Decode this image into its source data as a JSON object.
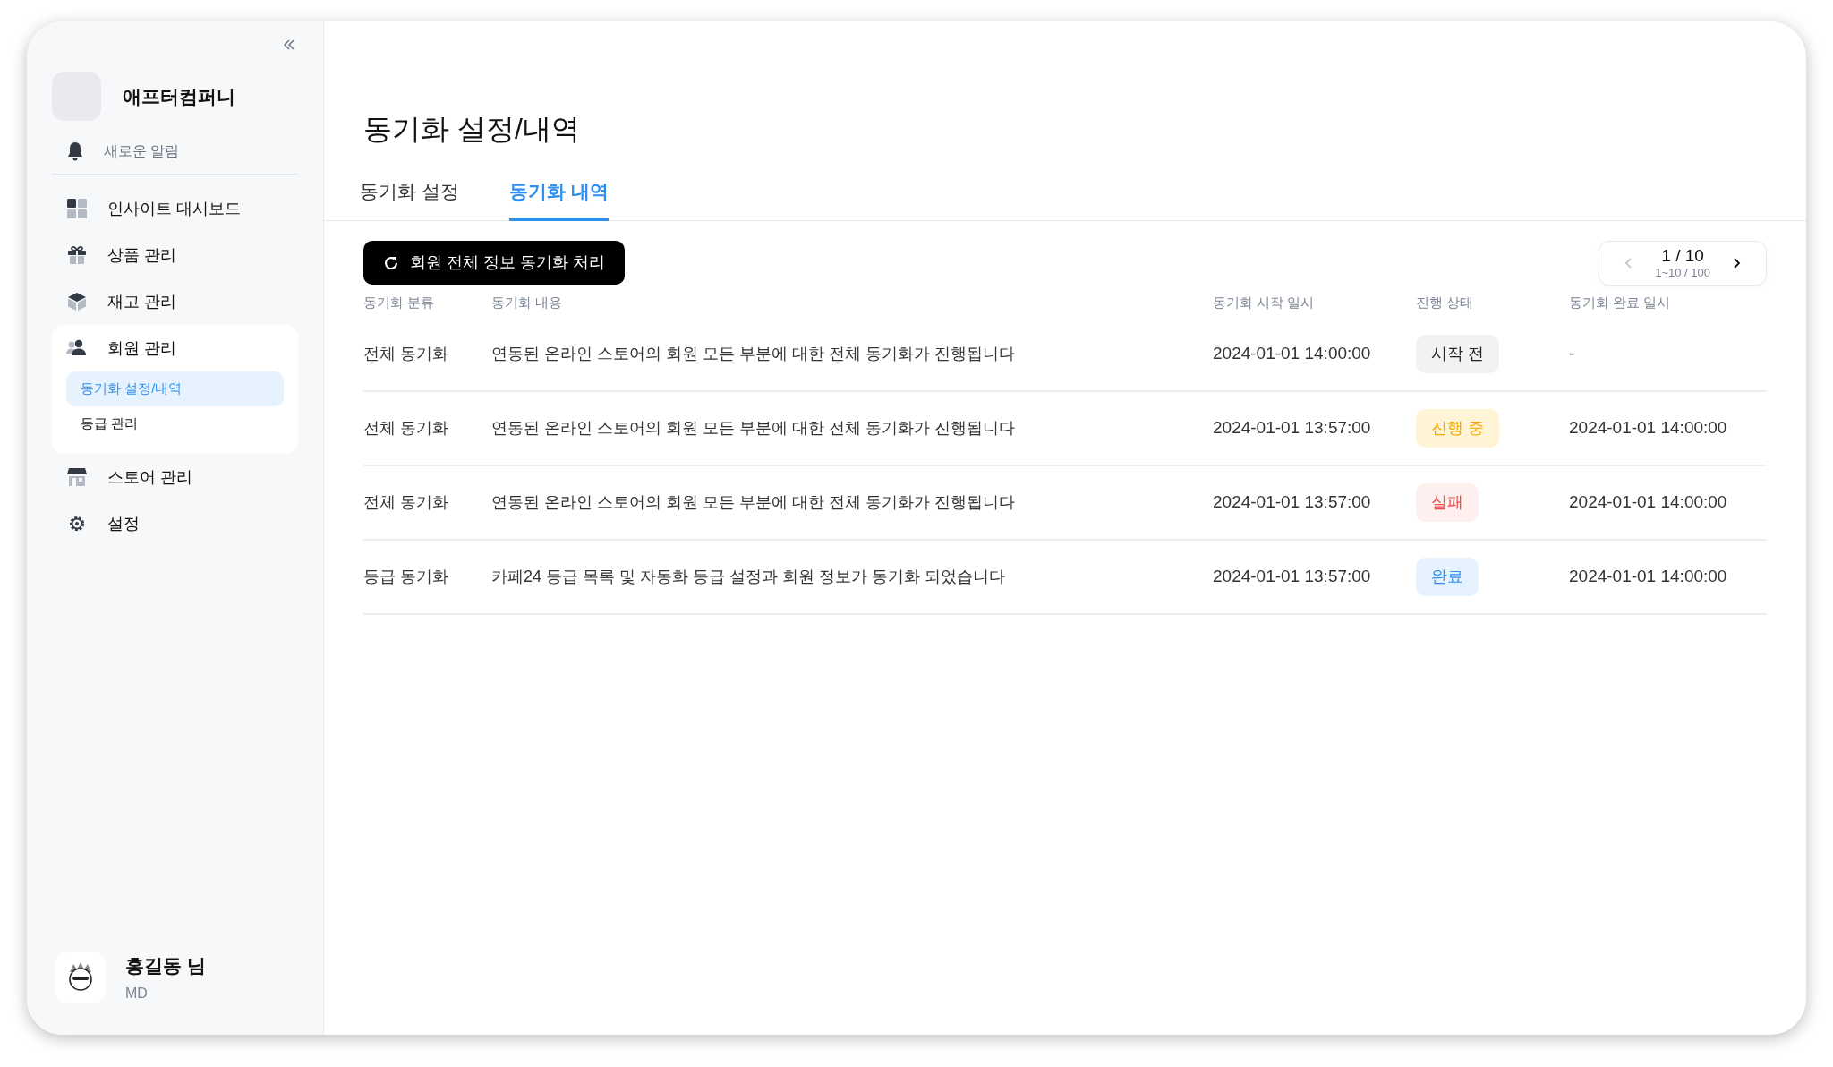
{
  "sidebar": {
    "company": "애프터컴퍼니",
    "notification": "새로운 알림",
    "items": [
      {
        "label": "인사이트 대시보드",
        "expanded": false
      },
      {
        "label": "상품 관리",
        "expanded": false
      },
      {
        "label": "재고 관리",
        "expanded": false
      },
      {
        "label": "회원 관리",
        "expanded": true,
        "children": [
          {
            "label": "동기화 설정/내역",
            "selected": true
          },
          {
            "label": "등급 관리",
            "selected": false
          }
        ]
      },
      {
        "label": "스토어 관리",
        "expanded": false
      },
      {
        "label": "설정",
        "expanded": false
      }
    ],
    "user": {
      "name": "홍길동 님",
      "role": "MD"
    }
  },
  "page": {
    "title": "동기화 설정/내역",
    "tabs": [
      {
        "label": "동기화 설정",
        "selected": false
      },
      {
        "label": "동기화 내역",
        "selected": true
      }
    ],
    "sync_button": "회원 전체 정보 동기화 처리",
    "pagination": {
      "page": "1 / 10",
      "range": "1~10 / 100",
      "prev_disabled": true,
      "next_disabled": false
    },
    "table": {
      "columns": [
        "동기화 분류",
        "동기화 내용",
        "동기화 시작 일시",
        "진행 상태",
        "동기화 완료 일시"
      ],
      "rows": [
        {
          "category": "전체 동기화",
          "content": "연동된 온라인 스토어의 회원 모든 부분에 대한 전체 동기화가 진행됩니다",
          "start": "2024-01-01 14:00:00",
          "status": {
            "label": "시작 전",
            "kind": "pending"
          },
          "end": "-"
        },
        {
          "category": "전체 동기화",
          "content": "연동된 온라인 스토어의 회원 모든 부분에 대한 전체 동기화가 진행됩니다",
          "start": "2024-01-01 13:57:00",
          "status": {
            "label": "진행 중",
            "kind": "running"
          },
          "end": "2024-01-01 14:00:00"
        },
        {
          "category": "전체 동기화",
          "content": "연동된 온라인 스토어의 회원 모든 부분에 대한 전체 동기화가 진행됩니다",
          "start": "2024-01-01 13:57:00",
          "status": {
            "label": "실패",
            "kind": "failed"
          },
          "end": "2024-01-01 14:00:00"
        },
        {
          "category": "등급 동기화",
          "content": "카페24 등급 목록 및 자동화 등급 설정과 회원 정보가 동기화 되었습니다",
          "start": "2024-01-01 13:57:00",
          "status": {
            "label": "완료",
            "kind": "done"
          },
          "end": "2024-01-01 14:00:00"
        }
      ]
    }
  }
}
